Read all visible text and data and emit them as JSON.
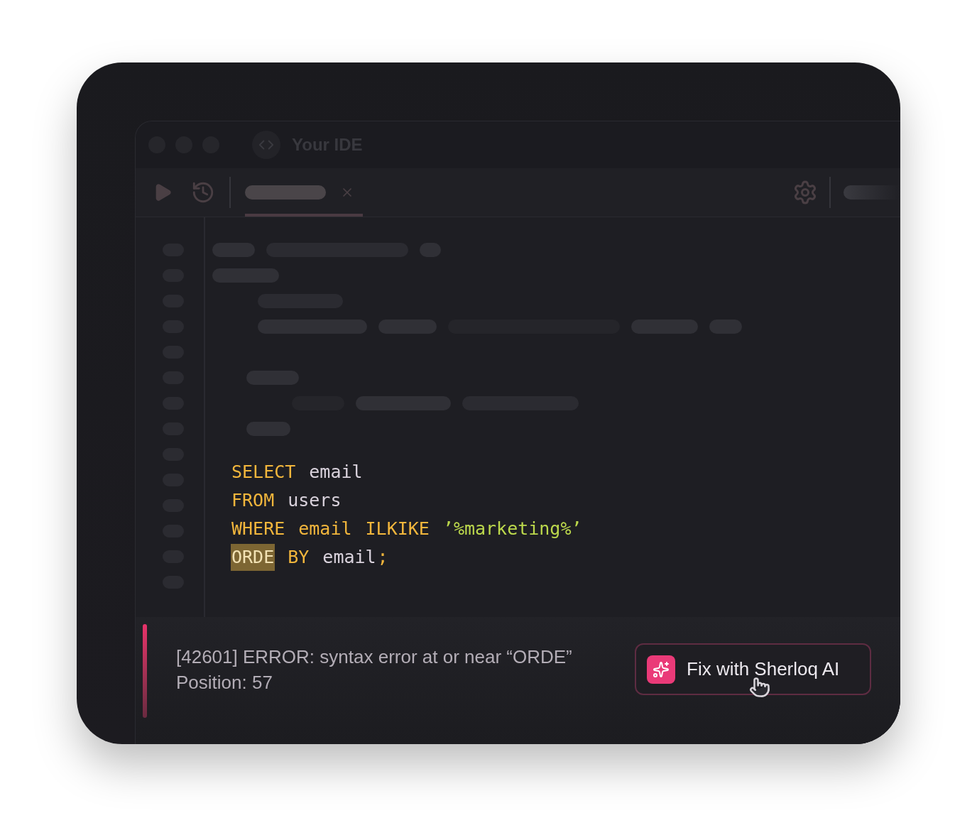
{
  "window": {
    "title": "Your IDE"
  },
  "code": [
    {
      "tokens": [
        {
          "kind": "keyword",
          "text": "SELECT"
        },
        {
          "kind": "ident",
          "text": "email"
        }
      ]
    },
    {
      "tokens": [
        {
          "kind": "keyword",
          "text": "FROM"
        },
        {
          "kind": "ident",
          "text": "users"
        }
      ]
    },
    {
      "tokens": [
        {
          "kind": "keyword",
          "text": "WHERE"
        },
        {
          "kind": "keyword",
          "text": "email"
        },
        {
          "kind": "keyword",
          "text": "ILKIKE"
        },
        {
          "kind": "string",
          "text": "’%marketing%’"
        }
      ]
    },
    {
      "tokens": [
        {
          "kind": "error",
          "text": "ORDE"
        },
        {
          "kind": "keyword",
          "text": "BY"
        },
        {
          "kind": "ident",
          "text": "email"
        },
        {
          "kind": "punctuation",
          "text": ";"
        }
      ]
    }
  ],
  "error": {
    "message": "[42601] ERROR: syntax error at or near “ORDE”",
    "position": "Position: 57"
  },
  "fix_button": {
    "label": "Fix with Sherloq AI"
  }
}
